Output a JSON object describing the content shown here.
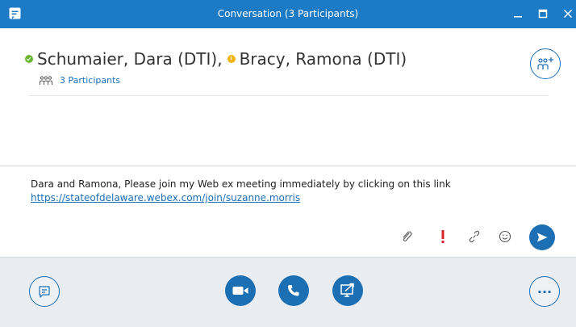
{
  "window": {
    "title": "Conversation (3 Participants)",
    "accent_color": "#1d7ac4"
  },
  "header": {
    "participants": [
      {
        "name": "Schumaier, Dara (DTI),",
        "presence": "available",
        "presence_color": "#6bb830"
      },
      {
        "name": "Bracy, Ramona (DTI)",
        "presence": "away",
        "presence_color": "#f2b417"
      }
    ],
    "participants_link": "3 Participants"
  },
  "compose": {
    "message_text": "Dara and Ramona, Please join my Web ex meeting immediately by clicking on this link",
    "message_link": "https://stateofdelaware.webex.com/join/suzanne.morris",
    "tools": [
      "paperclip-icon",
      "exclamation-icon",
      "link-icon",
      "emoji-icon",
      "send-icon"
    ]
  },
  "actions": [
    "chat-icon",
    "video-icon",
    "phone-icon",
    "screen-share-icon",
    "more-icon"
  ],
  "more_label": "···"
}
